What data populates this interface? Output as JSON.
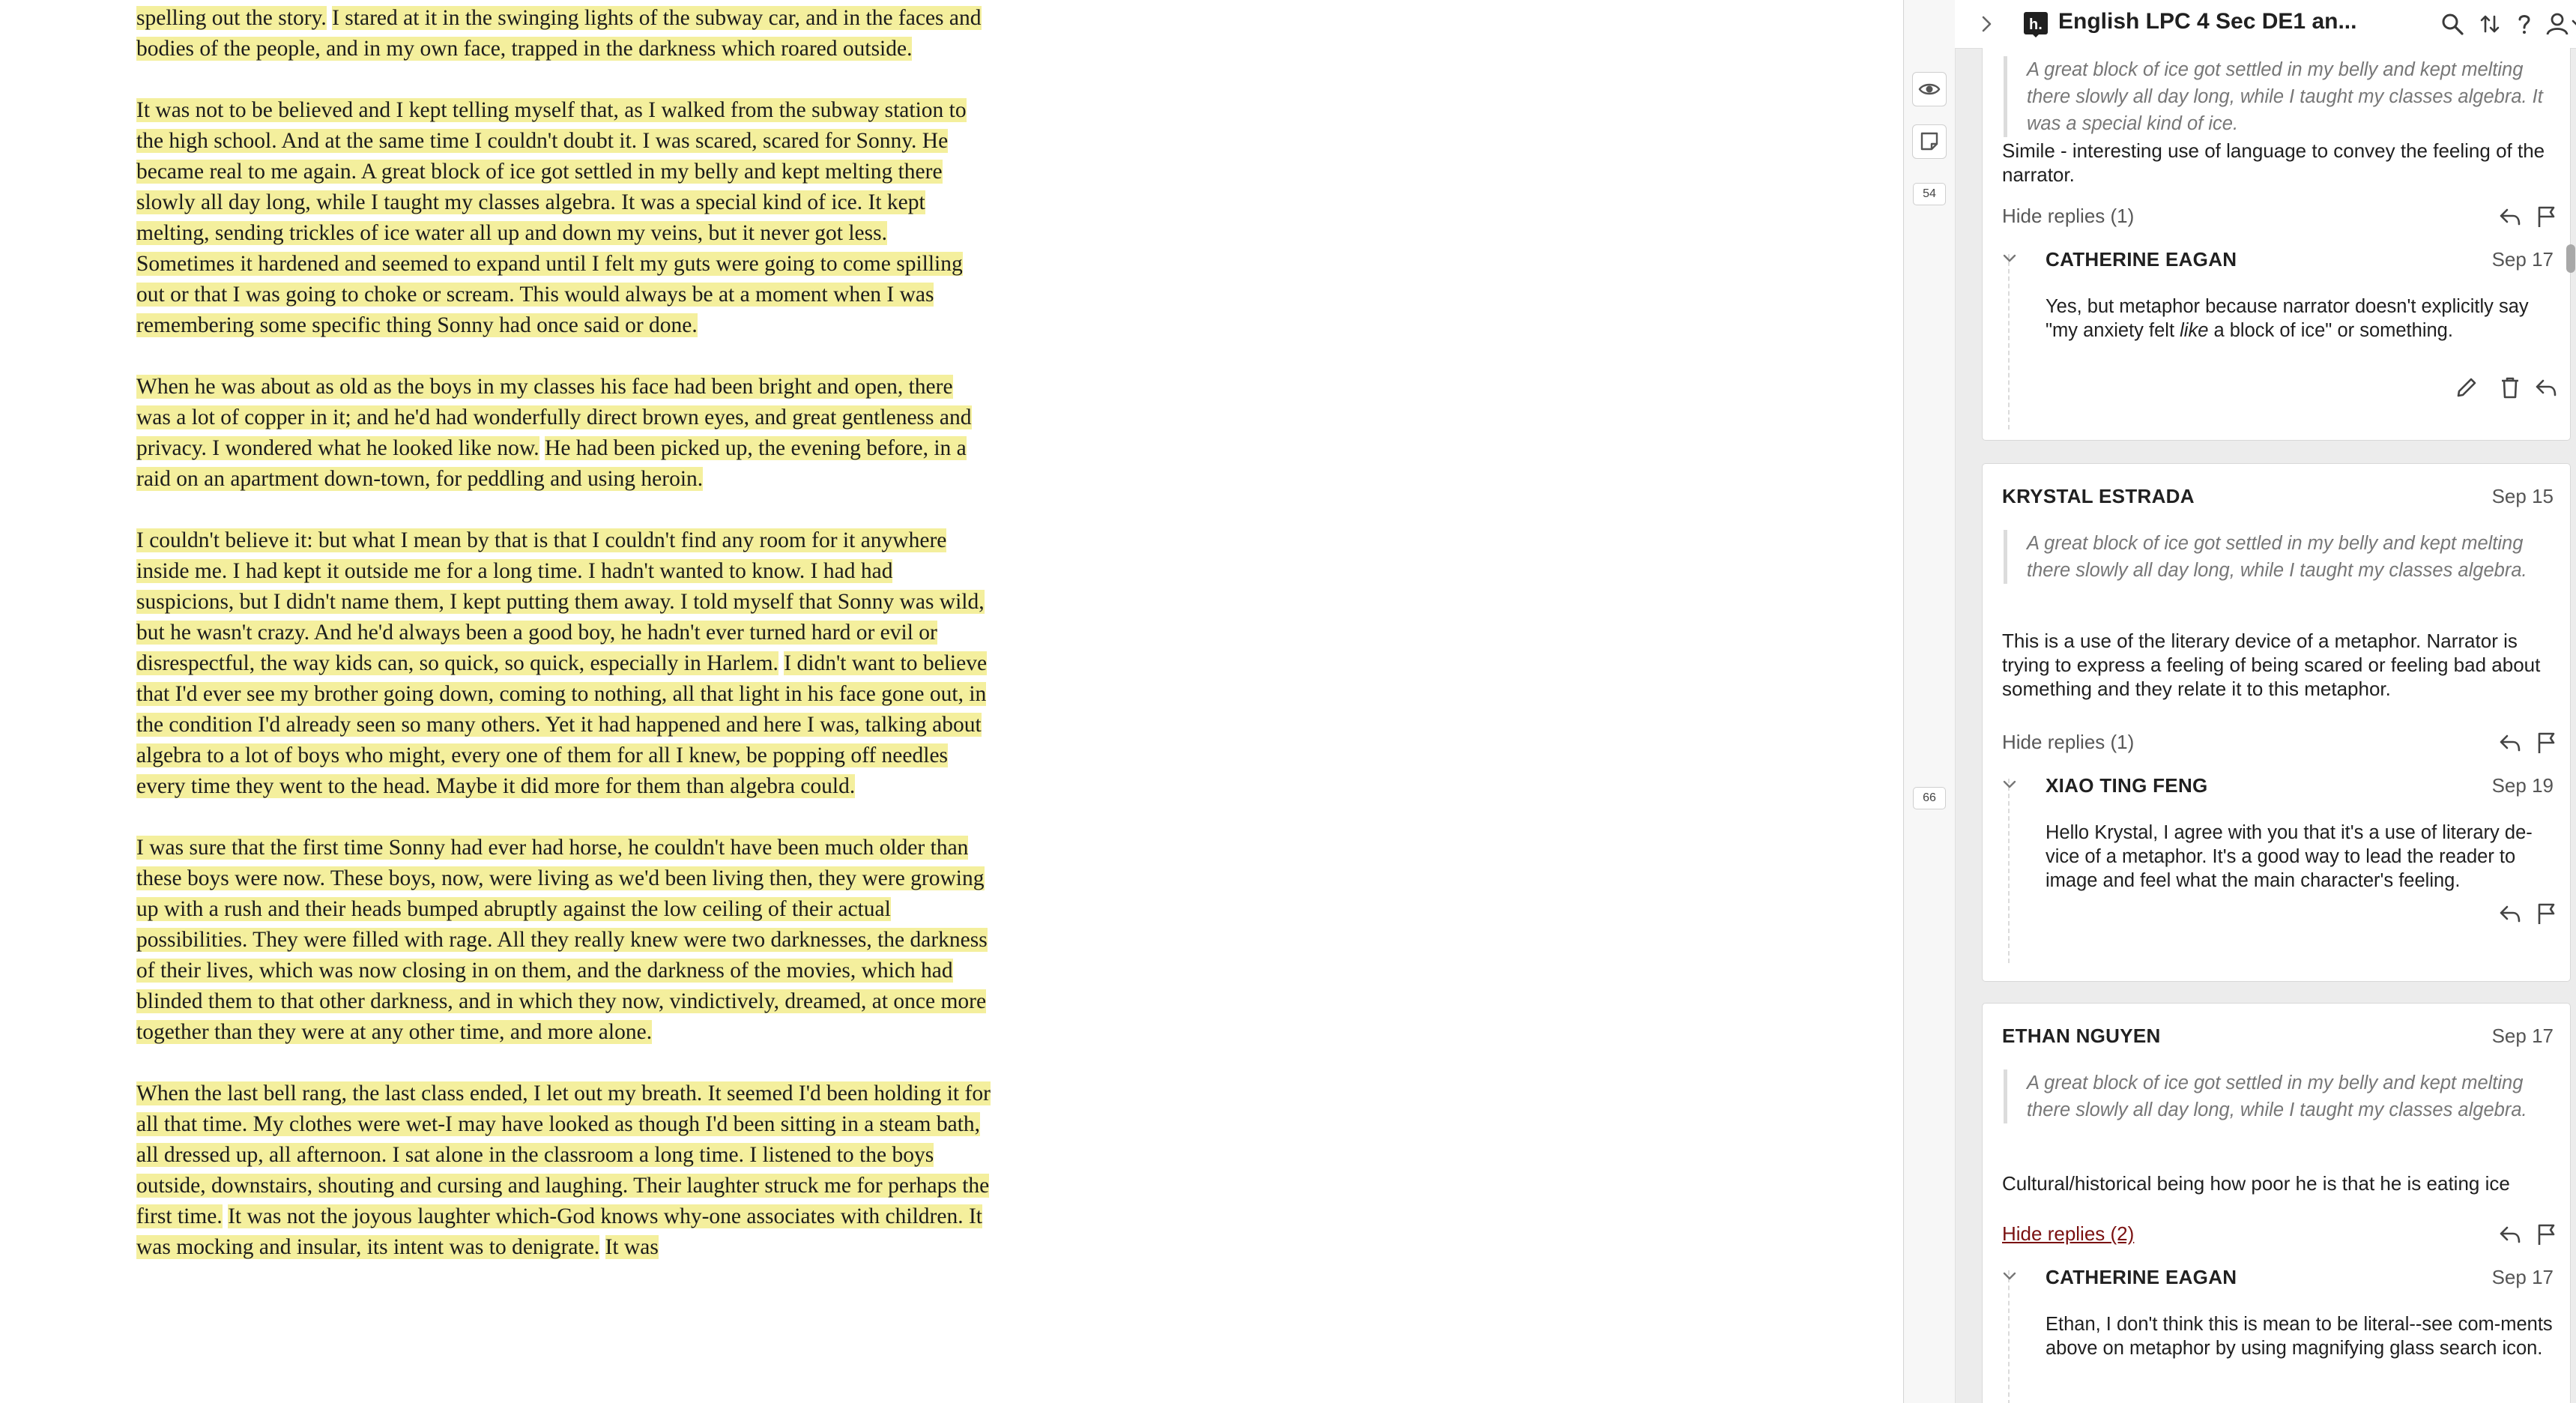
{
  "document": {
    "paragraphs": [
      [
        {
          "t": "spelling out the story.",
          "hl": true
        },
        {
          "t": " ",
          "hl": false
        },
        {
          "t": "I stared at it in the swinging lights of the subway car, and in the faces and bodies of the people, and in my own face, trapped in the darkness which roared outside.",
          "hl": true
        }
      ],
      [
        {
          "t": "It was not to be believed and I kept telling myself that, as I walked from the subway station to the high school. And at the same time I couldn't doubt it. I was scared, scared for Sonny. He became real to me again. A great block of ice got settled in my belly and kept melting there slowly all day long, while I taught my classes algebra. It was a special kind of ice. It kept melting, sending trickles of ice water all up and down my veins, but it never got less. Sometimes it hardened and seemed to expand until I felt my guts were going to come spilling out or that I was going to choke or scream. This would always be at a moment when I was remembering some specific thing Sonny had once said or done.",
          "hl": true
        }
      ],
      [
        {
          "t": "When he was about as old as the boys in my classes his face had been bright and open, there was a lot of copper in it; and he'd had wonderfully direct brown eyes, and great gentleness and privacy. I wondered what he looked like now.",
          "hl": true
        },
        {
          "t": " ",
          "hl": false
        },
        {
          "t": "He had been picked up, the evening before, in a raid on an apartment down-town, for peddling and using heroin.",
          "hl": true
        }
      ],
      [
        {
          "t": "I couldn't believe it: but what I mean by that is that I couldn't find any room for it anywhere inside me. I had kept it outside me for a long time. I hadn't wanted to know. I had had suspicions, but I didn't name them, I kept putting them away. I told myself that Sonny was wild, but he wasn't crazy. And he'd always been a good boy, he hadn't ever turned hard or evil or disrespectful, the way kids can, so quick, so quick, especially in Harlem.",
          "hl": true
        },
        {
          "t": " ",
          "hl": false
        },
        {
          "t": "I didn't want to believe that I'd ever see my brother going down, coming to nothing, all that light in his face gone out, in the condition I'd already seen so many others. Yet it had happened and here I was, talking about algebra to a lot of boys who might, every one of them for all I knew, be popping off needles every time they went to the head. Maybe it did more for them than algebra could.",
          "hl": true
        }
      ],
      [
        {
          "t": "I was sure that the first time Sonny had ever had horse, he couldn't have been much older than these boys were now. These boys, now, were living as we'd been living then, they were growing up with a rush and their heads bumped abruptly against the low ceiling of their actual possibilities. They were filled with rage. All they really knew were two darknesses, the darkness of their lives, which was now closing in on them, and the darkness of the movies, which had blinded them to that other darkness, and in which they now, vindictively, dreamed, at once more together than they were at any other time, and more alone.",
          "hl": true
        }
      ],
      [
        {
          "t": "When the last bell rang, the last class ended, I let out my breath. It seemed I'd been holding it for all that time. My clothes were wet-I may have looked as though I'd been sitting in a steam bath, all dressed up, all afternoon. I sat alone in the classroom a long time. I listened to the boys outside, downstairs, shouting and cursing and laughing. Their laughter struck me for perhaps the first time.",
          "hl": true
        },
        {
          "t": " ",
          "hl": false
        },
        {
          "t": "It was not the joyous laughter which-God knows why-one associates with children. It was mocking and insular, its intent was to denigrate.",
          "hl": true
        },
        {
          "t": " ",
          "hl": false
        },
        {
          "t": "It was",
          "hl": true
        }
      ]
    ]
  },
  "sidebar": {
    "group_name": "English LPC 4 Sec DE1 an...",
    "bucket_counts": [
      "54",
      "66"
    ],
    "icons": {
      "collapse": "chevron-right-icon",
      "logo": "hypothesis-logo-icon",
      "search": "search-icon",
      "sort": "sort-icon",
      "help": "help-icon",
      "user": "user-icon",
      "user_menu": "chevron-down-icon",
      "show_highlights": "eye-icon",
      "notes": "note-icon"
    },
    "cards": [
      {
        "quote": "A great block of ice got settled in my belly and kept melting there slowly all day long, while I taught my classes algebra. It was a special kind of ice.",
        "body": "Simile - interesting use of language to convey the feeling of the narrator.",
        "toggle": "Hide replies (1)",
        "replies": [
          {
            "author": "CATHERINE EAGAN",
            "date": "Sep 17",
            "body_before": "Yes, but metaphor because narrator doesn't explicitly say \"my anxiety felt ",
            "body_em": "like",
            "body_after": " a block of ice\" or something."
          }
        ]
      },
      {
        "author": "KRYSTAL ESTRADA",
        "date": "Sep 15",
        "quote": "A great block of ice got settled in my belly and kept melting there slowly all day long, while I taught my classes algebra.",
        "body": "This is a use of the literary device of a metaphor. Narrator is trying to express a feeling of being scared or feeling bad about something and they relate it to this metaphor.",
        "toggle": "Hide replies (1)",
        "replies": [
          {
            "author": "XIAO TING FENG",
            "date": "Sep 19",
            "body": "Hello Krystal, I agree with you that it's a use of literary de-vice of a metaphor. It's a good way to lead the reader to image and feel what the main character's feeling."
          }
        ]
      },
      {
        "author": "ETHAN NGUYEN",
        "date": "Sep 17",
        "quote": "A great block of ice got settled in my belly and kept melting there slowly all day long, while I taught my classes algebra.",
        "body": "Cultural/historical being how poor he is that he is eating ice",
        "toggle": "Hide replies (2)",
        "replies": [
          {
            "author": "CATHERINE EAGAN",
            "date": "Sep 17",
            "body": "Ethan, I don't think this is mean to be literal--see com-ments above on metaphor by using magnifying glass search icon."
          }
        ]
      }
    ]
  },
  "colors": {
    "highlight": "#f4ef9d",
    "link": "#7a1111",
    "sidebar_bg": "#ececec"
  }
}
